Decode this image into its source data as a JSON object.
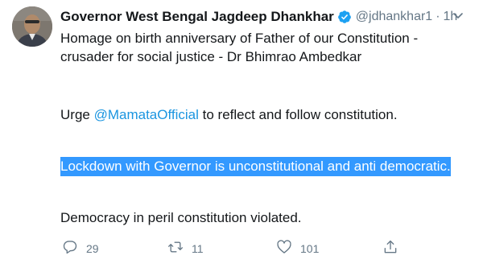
{
  "tweet": {
    "author_name": "Governor West Bengal Jagdeep Dhankhar",
    "handle": "@jdhankhar1",
    "separator": "·",
    "time": "1h",
    "text_line1": "Homage on birth anniversary of Father of our Constitution -crusader for social justice - Dr Bhimrao Ambedkar",
    "text_line2_prefix": "Urge ",
    "mention": "@MamataOfficial",
    "text_line2_suffix": " to reflect and follow constitution.",
    "highlighted_text": "Lockdown with Governor is unconstitutional and anti democratic.",
    "text_line4": "Democracy in peril constitution violated."
  },
  "actions": {
    "reply_count": "29",
    "retweet_count": "11",
    "like_count": "101"
  },
  "colors": {
    "link": "#1b95e0",
    "muted": "#657786",
    "verified": "#1da1f2",
    "highlight": "#3399ff"
  },
  "icons": {
    "avatar": "avatar",
    "verified": "verified-badge-icon",
    "menu": "chevron-down-icon",
    "reply": "reply-icon",
    "retweet": "retweet-icon",
    "like": "heart-icon",
    "share": "share-icon"
  }
}
